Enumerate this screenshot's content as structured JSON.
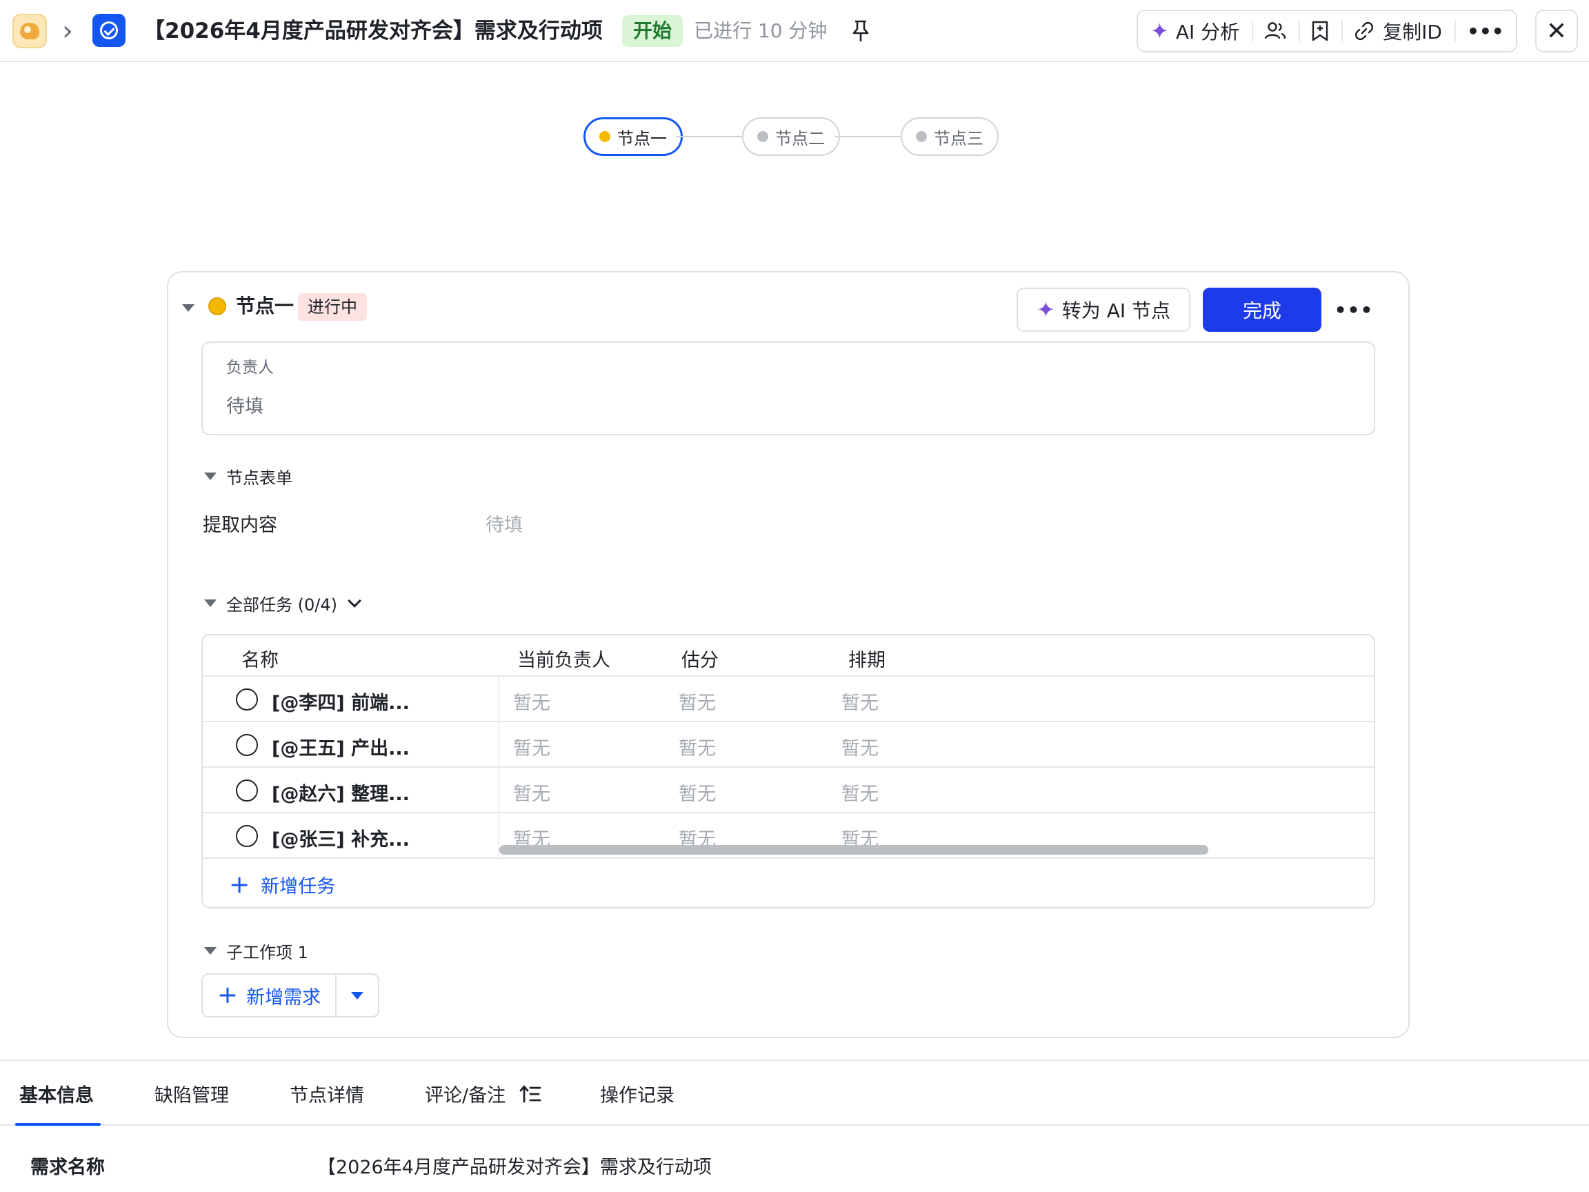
{
  "header": {
    "title": "【2026年4月度产品研发对齐会】需求及行动项",
    "status": "开始",
    "elapsed": "已进行 10 分钟",
    "toolbar": {
      "ai_label": "AI 分析",
      "copy_id_label": "复制ID"
    }
  },
  "flow": {
    "steps": [
      {
        "label": "节点一"
      },
      {
        "label": "节点二"
      },
      {
        "label": "节点三"
      }
    ]
  },
  "node": {
    "name": "节点一",
    "status": "进行中",
    "ai_button": "转为 AI 节点",
    "done_button": "完成",
    "owner_label": "负责人",
    "owner_value": "待填",
    "form_section": "节点表单",
    "field_label": "提取内容",
    "field_value": "待填",
    "tasks_section": "全部任务 (0/4)",
    "table": {
      "columns": [
        "名称",
        "当前负责人",
        "估分",
        "排期"
      ],
      "rows": [
        {
          "name": "[@李四] 前端...",
          "owner": "暂无",
          "estimate": "暂无",
          "schedule": "暂无"
        },
        {
          "name": "[@王五] 产出...",
          "owner": "暂无",
          "estimate": "暂无",
          "schedule": "暂无"
        },
        {
          "name": "[@赵六] 整理...",
          "owner": "暂无",
          "estimate": "暂无",
          "schedule": "暂无"
        },
        {
          "name": "[@张三] 补充...",
          "owner": "暂无",
          "estimate": "暂无",
          "schedule": "暂无"
        }
      ]
    },
    "add_task": "新增任务",
    "sub_items_section": "子工作项 1",
    "add_requirement": "新增需求"
  },
  "tabs": [
    {
      "label": "基本信息"
    },
    {
      "label": "缺陷管理"
    },
    {
      "label": "节点详情"
    },
    {
      "label": "评论/备注"
    },
    {
      "label": "操作记录"
    }
  ],
  "basic_info": {
    "label": "需求名称",
    "value": "【2026年4月度产品研发对齐会】需求及行动项"
  },
  "colors": {
    "accent": "#1456f0",
    "primary_button": "#1d3be8",
    "node_dot": "#f5b800",
    "status_start_bg": "#d9f5d6",
    "status_progress_bg": "#fde2e2"
  }
}
